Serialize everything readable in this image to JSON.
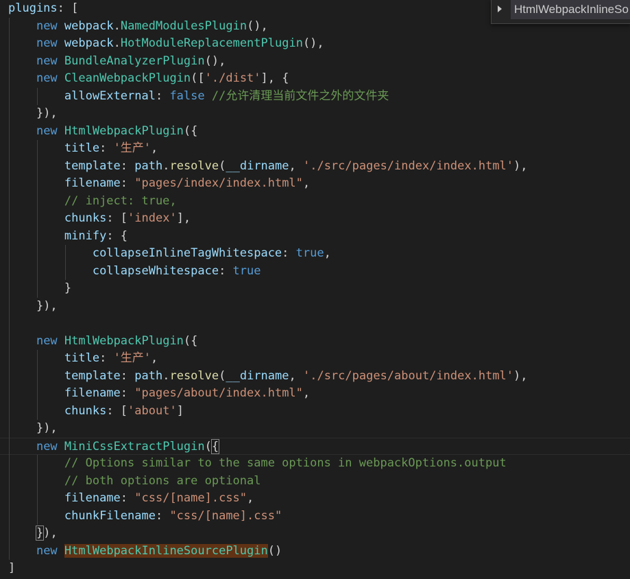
{
  "editor": {
    "lines": [
      [
        [
          "plugins",
          "var"
        ],
        [
          ": [",
          "pun"
        ]
      ],
      [
        [
          "    ",
          "pun"
        ],
        [
          "new",
          "kw"
        ],
        [
          " ",
          "pun"
        ],
        [
          "webpack",
          "var"
        ],
        [
          ".",
          "pun"
        ],
        [
          "NamedModulesPlugin",
          "cls"
        ],
        [
          "(),",
          "pun"
        ]
      ],
      [
        [
          "    ",
          "pun"
        ],
        [
          "new",
          "kw"
        ],
        [
          " ",
          "pun"
        ],
        [
          "webpack",
          "var"
        ],
        [
          ".",
          "pun"
        ],
        [
          "HotModuleReplacementPlugin",
          "cls"
        ],
        [
          "(),",
          "pun"
        ]
      ],
      [
        [
          "    ",
          "pun"
        ],
        [
          "new",
          "kw"
        ],
        [
          " ",
          "pun"
        ],
        [
          "BundleAnalyzerPlugin",
          "cls"
        ],
        [
          "(),",
          "pun"
        ]
      ],
      [
        [
          "    ",
          "pun"
        ],
        [
          "new",
          "kw"
        ],
        [
          " ",
          "pun"
        ],
        [
          "CleanWebpackPlugin",
          "cls"
        ],
        [
          "([",
          "pun"
        ],
        [
          "'./dist'",
          "str"
        ],
        [
          "], {",
          "pun"
        ]
      ],
      [
        [
          "        ",
          "pun"
        ],
        [
          "allowExternal",
          "var"
        ],
        [
          ": ",
          "pun"
        ],
        [
          "false",
          "bool"
        ],
        [
          " ",
          "pun"
        ],
        [
          "//允许清理当前文件之外的文件夹",
          "cmt"
        ]
      ],
      [
        [
          "    ",
          "pun"
        ],
        [
          "}),",
          "pun"
        ]
      ],
      [
        [
          "    ",
          "pun"
        ],
        [
          "new",
          "kw"
        ],
        [
          " ",
          "pun"
        ],
        [
          "HtmlWebpackPlugin",
          "cls"
        ],
        [
          "({",
          "pun"
        ]
      ],
      [
        [
          "        ",
          "pun"
        ],
        [
          "title",
          "var"
        ],
        [
          ": ",
          "pun"
        ],
        [
          "'生产'",
          "str"
        ],
        [
          ",",
          "pun"
        ]
      ],
      [
        [
          "        ",
          "pun"
        ],
        [
          "template",
          "var"
        ],
        [
          ": ",
          "pun"
        ],
        [
          "path",
          "var"
        ],
        [
          ".",
          "pun"
        ],
        [
          "resolve",
          "fn"
        ],
        [
          "(",
          "pun"
        ],
        [
          "__dirname",
          "var"
        ],
        [
          ", ",
          "pun"
        ],
        [
          "'./src/pages/index/index.html'",
          "str"
        ],
        [
          "),",
          "pun"
        ]
      ],
      [
        [
          "        ",
          "pun"
        ],
        [
          "filename",
          "var"
        ],
        [
          ": ",
          "pun"
        ],
        [
          "\"pages/index/index.html\"",
          "str"
        ],
        [
          ",",
          "pun"
        ]
      ],
      [
        [
          "        ",
          "pun"
        ],
        [
          "// inject: true,",
          "cmt"
        ]
      ],
      [
        [
          "        ",
          "pun"
        ],
        [
          "chunks",
          "var"
        ],
        [
          ": [",
          "pun"
        ],
        [
          "'index'",
          "str"
        ],
        [
          "],",
          "pun"
        ]
      ],
      [
        [
          "        ",
          "pun"
        ],
        [
          "minify",
          "var"
        ],
        [
          ": {",
          "pun"
        ]
      ],
      [
        [
          "            ",
          "pun"
        ],
        [
          "collapseInlineTagWhitespace",
          "var"
        ],
        [
          ": ",
          "pun"
        ],
        [
          "true",
          "bool"
        ],
        [
          ",",
          "pun"
        ]
      ],
      [
        [
          "            ",
          "pun"
        ],
        [
          "collapseWhitespace",
          "var"
        ],
        [
          ": ",
          "pun"
        ],
        [
          "true",
          "bool"
        ]
      ],
      [
        [
          "        ",
          "pun"
        ],
        [
          "}",
          "pun"
        ]
      ],
      [
        [
          "    ",
          "pun"
        ],
        [
          "}),",
          "pun"
        ]
      ],
      [],
      [
        [
          "    ",
          "pun"
        ],
        [
          "new",
          "kw"
        ],
        [
          " ",
          "pun"
        ],
        [
          "HtmlWebpackPlugin",
          "cls"
        ],
        [
          "({",
          "pun"
        ]
      ],
      [
        [
          "        ",
          "pun"
        ],
        [
          "title",
          "var"
        ],
        [
          ": ",
          "pun"
        ],
        [
          "'生产'",
          "str"
        ],
        [
          ",",
          "pun"
        ]
      ],
      [
        [
          "        ",
          "pun"
        ],
        [
          "template",
          "var"
        ],
        [
          ": ",
          "pun"
        ],
        [
          "path",
          "var"
        ],
        [
          ".",
          "pun"
        ],
        [
          "resolve",
          "fn"
        ],
        [
          "(",
          "pun"
        ],
        [
          "__dirname",
          "var"
        ],
        [
          ", ",
          "pun"
        ],
        [
          "'./src/pages/about/index.html'",
          "str"
        ],
        [
          "),",
          "pun"
        ]
      ],
      [
        [
          "        ",
          "pun"
        ],
        [
          "filename",
          "var"
        ],
        [
          ": ",
          "pun"
        ],
        [
          "\"pages/about/index.html\"",
          "str"
        ],
        [
          ",",
          "pun"
        ]
      ],
      [
        [
          "        ",
          "pun"
        ],
        [
          "chunks",
          "var"
        ],
        [
          ": [",
          "pun"
        ],
        [
          "'about'",
          "str"
        ],
        [
          "]",
          "pun"
        ]
      ],
      [
        [
          "    ",
          "pun"
        ],
        [
          "}),",
          "pun"
        ]
      ],
      [
        [
          "    ",
          "pun"
        ],
        [
          "new",
          "kw"
        ],
        [
          " ",
          "pun"
        ],
        [
          "MiniCssExtractPlugin",
          "cls"
        ],
        [
          "(",
          "pun"
        ],
        [
          "{",
          "pun box"
        ]
      ],
      [
        [
          "        ",
          "pun"
        ],
        [
          "// Options similar to the same options in webpackOptions.output",
          "cmt"
        ]
      ],
      [
        [
          "        ",
          "pun"
        ],
        [
          "// both options are optional",
          "cmt"
        ]
      ],
      [
        [
          "        ",
          "pun"
        ],
        [
          "filename",
          "var"
        ],
        [
          ": ",
          "pun"
        ],
        [
          "\"css/[name].css\"",
          "str"
        ],
        [
          ",",
          "pun"
        ]
      ],
      [
        [
          "        ",
          "pun"
        ],
        [
          "chunkFilename",
          "var"
        ],
        [
          ": ",
          "pun"
        ],
        [
          "\"css/[name].css\"",
          "str"
        ]
      ],
      [
        [
          "    ",
          "pun"
        ],
        [
          "}",
          "pun box"
        ],
        [
          "),",
          "pun"
        ]
      ],
      [
        [
          "    ",
          "pun"
        ],
        [
          "new",
          "kw"
        ],
        [
          " ",
          "pun"
        ],
        [
          "HtmlWebpackInlineSourcePlugin",
          "cls hl"
        ],
        [
          "()",
          "pun"
        ]
      ],
      [
        [
          "]",
          "pun"
        ]
      ]
    ]
  },
  "peek": {
    "label": "HtmlWebpackInlineSo"
  }
}
